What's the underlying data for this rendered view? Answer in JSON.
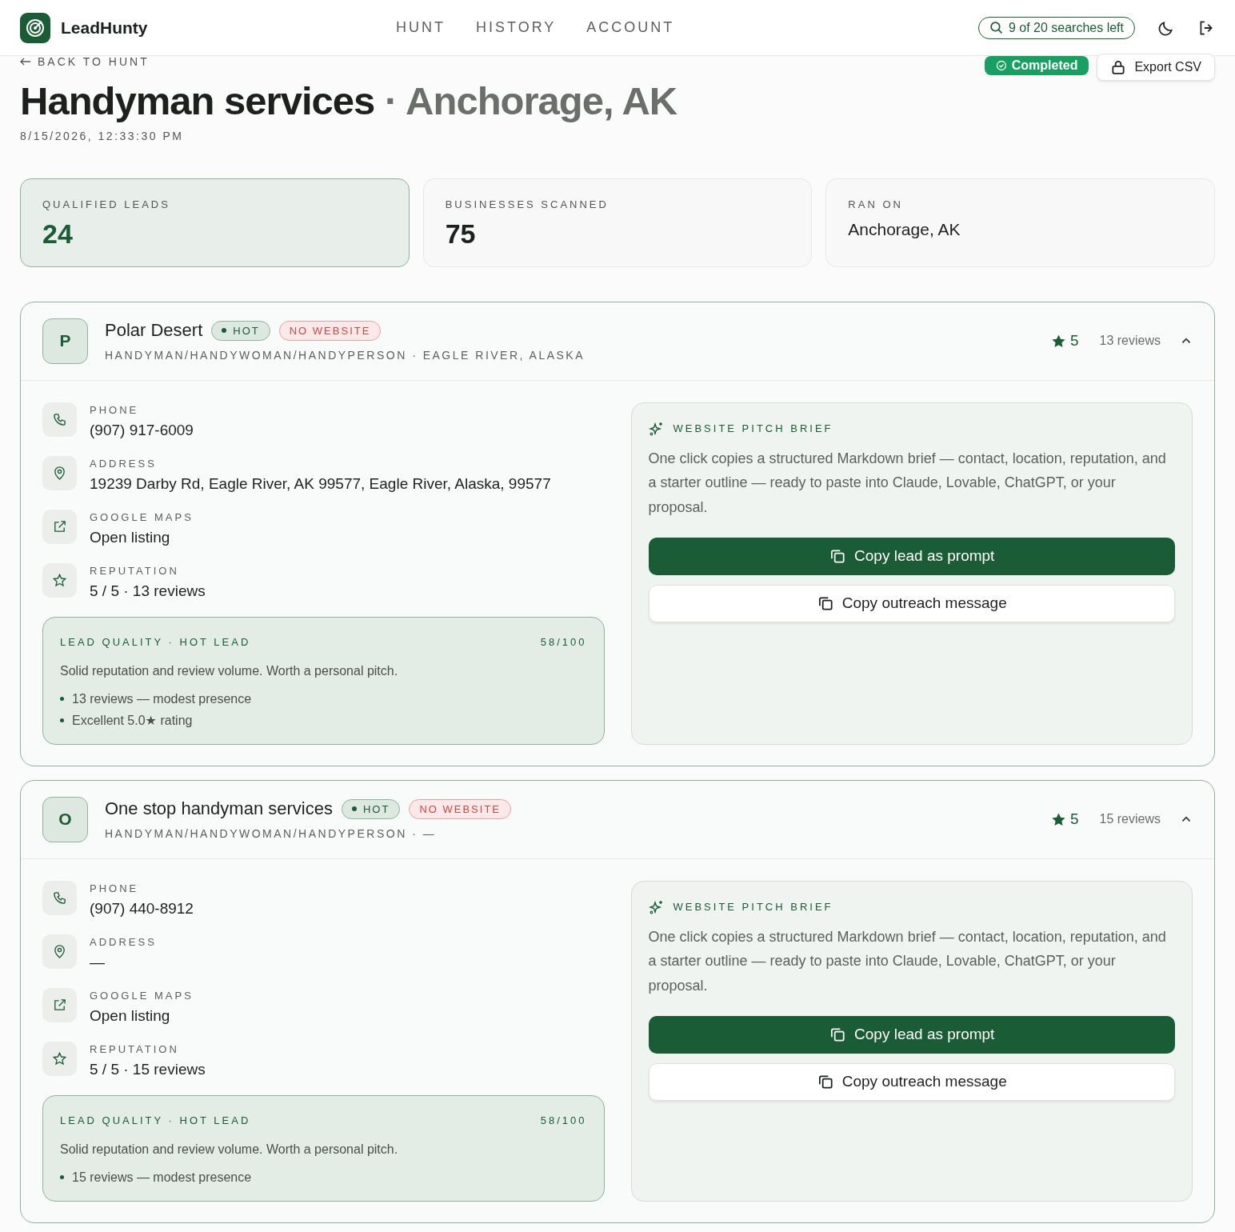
{
  "header": {
    "brand": "LeadHunty",
    "nav": [
      {
        "label": "HUNT",
        "selected": false
      },
      {
        "label": "HISTORY",
        "selected": false
      },
      {
        "label": "ACCOUNT",
        "selected": false
      }
    ],
    "quota": "9 of 20 searches left"
  },
  "back_link": "BACK TO HUNT",
  "status": "Completed",
  "export": "Export CSV",
  "title": {
    "query": "Handyman services",
    "separator": "·",
    "location": "Anchorage, AK"
  },
  "timestamp": "8/15/2026, 12:33:30 PM",
  "stats": [
    {
      "label": "QUALIFIED LEADS",
      "value": "24",
      "kind": "highlight"
    },
    {
      "label": "BUSINESSES SCANNED",
      "value": "75",
      "kind": "number"
    },
    {
      "label": "RAN ON",
      "value": "Anchorage, AK",
      "kind": "text"
    }
  ],
  "leads": [
    {
      "initial": "P",
      "name": "Polar Desert",
      "tags": [
        {
          "label": "HOT",
          "kind": "hot"
        },
        {
          "label": "NO WEBSITE",
          "kind": "warning"
        }
      ],
      "category": "HANDYMAN/HANDYWOMAN/HANDYPERSON · EAGLE RIVER, ALASKA",
      "rating": "5",
      "reviews": "13 reviews",
      "expanded": true,
      "details": [
        {
          "kind": "phone",
          "label": "PHONE",
          "value": "(907) 917-6009"
        },
        {
          "kind": "address",
          "label": "ADDRESS",
          "value": "19239 Darby Rd, Eagle River, AK 99577, Eagle River, Alaska, 99577"
        },
        {
          "kind": "maps",
          "label": "GOOGLE MAPS",
          "value": "Open listing"
        },
        {
          "kind": "reputation",
          "label": "REPUTATION",
          "value": "5 / 5 · 13 reviews"
        }
      ],
      "quality": {
        "title": "LEAD QUALITY · HOT LEAD",
        "score": "58/100",
        "summary": "Solid reputation and review volume. Worth a personal pitch.",
        "bullets": [
          "13 reviews — modest presence",
          "Excellent 5.0★ rating"
        ]
      },
      "pitch": {
        "title": "WEBSITE PITCH BRIEF",
        "description": "One click copies a structured Markdown brief — contact, location, reputation, and a starter outline — ready to paste into Claude, Lovable, ChatGPT, or your proposal.",
        "buttons": [
          {
            "label": "Copy lead as prompt",
            "kind": "primary"
          },
          {
            "label": "Copy outreach message",
            "kind": "secondary"
          }
        ]
      }
    },
    {
      "initial": "O",
      "name": "One stop handyman services",
      "tags": [
        {
          "label": "HOT",
          "kind": "hot"
        },
        {
          "label": "NO WEBSITE",
          "kind": "warning"
        }
      ],
      "category": "HANDYMAN/HANDYWOMAN/HANDYPERSON · —",
      "rating": "5",
      "reviews": "15 reviews",
      "expanded": true,
      "details": [
        {
          "kind": "phone",
          "label": "PHONE",
          "value": "(907) 440-8912"
        },
        {
          "kind": "address",
          "label": "ADDRESS",
          "value": "—"
        },
        {
          "kind": "maps",
          "label": "GOOGLE MAPS",
          "value": "Open listing"
        },
        {
          "kind": "reputation",
          "label": "REPUTATION",
          "value": "5 / 5 · 15 reviews"
        }
      ],
      "quality": {
        "title": "LEAD QUALITY · HOT LEAD",
        "score": "58/100",
        "summary": "Solid reputation and review volume. Worth a personal pitch.",
        "bullets": [
          "15 reviews — modest presence"
        ]
      },
      "pitch": {
        "title": "WEBSITE PITCH BRIEF",
        "description": "One click copies a structured Markdown brief — contact, location, reputation, and a starter outline — ready to paste into Claude, Lovable, ChatGPT, or your proposal.",
        "buttons": [
          {
            "label": "Copy lead as prompt",
            "kind": "primary"
          },
          {
            "label": "Copy outreach message",
            "kind": "secondary"
          }
        ]
      }
    }
  ]
}
